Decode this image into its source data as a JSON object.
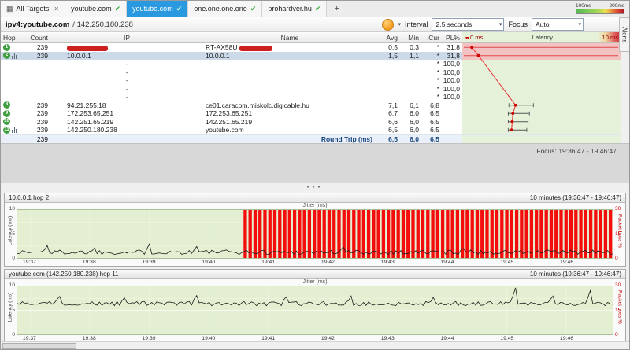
{
  "tabs": [
    {
      "label": "All Targets",
      "icon": "grid",
      "close": "✕"
    },
    {
      "label": "youtube.com",
      "check": "✔"
    },
    {
      "label": "youtube.com",
      "check": "✔",
      "active": true
    },
    {
      "label": "one.one.one.one",
      "check": "✔"
    },
    {
      "label": "prohardver.hu",
      "check": "✔"
    },
    {
      "label": "+",
      "plus": true
    }
  ],
  "legend": {
    "label1": "100ms",
    "label2": "200ms"
  },
  "alerts_label": "Alerts",
  "toolbar": {
    "target": "ipv4:youtube.com",
    "target_ip": "/ 142.250.180.238",
    "interval_label": "Interval",
    "interval_value": "2.5 seconds",
    "focus_label": "Focus",
    "focus_value": "Auto"
  },
  "table": {
    "header": {
      "hop": "Hop",
      "count": "Count",
      "ip": "IP",
      "name": "Name",
      "avg": "Avg",
      "min": "Min",
      "cur": "Cur",
      "pl": "PL%",
      "lat_left": "0 ms",
      "lat_title": "Latency",
      "lat_right": "10 ms"
    },
    "rows": [
      {
        "hop": "1",
        "count": "239",
        "ip": "",
        "ip_redacted": true,
        "name": "RT-AX58U",
        "name_redacted": true,
        "avg": "0,5",
        "min": "0,3",
        "cur": "*",
        "pl": "31,8",
        "loss": true,
        "lat": {
          "min": 0.3,
          "avg": 0.5,
          "max": 20
        }
      },
      {
        "hop": "2",
        "count": "239",
        "ip": "10.0.0.1",
        "name": "10.0.0.1",
        "avg": "1,5",
        "min": "1,1",
        "cur": "*",
        "pl": "31,8",
        "loss": true,
        "selected": true,
        "chart_icon": true,
        "lat": {
          "min": 1.1,
          "avg": 1.5,
          "max": 20
        }
      },
      {
        "dash": "-",
        "cur": "*",
        "pl": "100,0"
      },
      {
        "dash": "-",
        "cur": "*",
        "pl": "100,0"
      },
      {
        "dash": "-",
        "cur": "*",
        "pl": "100,0"
      },
      {
        "dash": "-",
        "cur": "*",
        "pl": "100,0"
      },
      {
        "dash": "-",
        "cur": "*",
        "pl": "100,0"
      },
      {
        "hop": "8",
        "count": "239",
        "ip": "94.21.255.18",
        "name": "ce01.caracom.miskolc.digicable.hu",
        "avg": "7,1",
        "min": "6,1",
        "cur": "6,8",
        "lat": {
          "min": 6.1,
          "avg": 7.1,
          "max": 9.8
        }
      },
      {
        "hop": "9",
        "count": "239",
        "ip": "172.253.65.251",
        "name": "172.253.65.251",
        "avg": "6,7",
        "min": "6,0",
        "cur": "6,5",
        "lat": {
          "min": 6.0,
          "avg": 6.7,
          "max": 9.2
        }
      },
      {
        "hop": "10",
        "count": "239",
        "ip": "142.251.65.219",
        "name": "142.251.65.219",
        "avg": "6,6",
        "min": "6,0",
        "cur": "6,5",
        "lat": {
          "min": 6.0,
          "avg": 6.6,
          "max": 9.0
        }
      },
      {
        "hop": "11",
        "count": "239",
        "ip": "142.250.180.238",
        "name": "youtube.com",
        "avg": "6,5",
        "min": "6,0",
        "cur": "6,5",
        "chart_icon": true,
        "lat": {
          "min": 6.0,
          "avg": 6.5,
          "max": 8.8
        }
      }
    ],
    "round_trip": {
      "count": "239",
      "label": "Round Trip (ms)",
      "avg": "6,5",
      "min": "6,0",
      "cur": "6,5"
    },
    "focus_text": "Focus: 19:36:47 - 19:46:47"
  },
  "scale_max_ms": 20,
  "graphs": [
    {
      "title": "10.0.0.1 hop 2",
      "range": "10 minutes (19:36:47 - 19:46:47)",
      "top_label": "Jitter (ms)",
      "y_left": "Latency (ms)",
      "y_right": "Packet Loss %",
      "left_ticks": [
        "10",
        "5",
        "0"
      ],
      "right_ticks": [
        "30",
        "15",
        "0"
      ],
      "x_ticks": [
        "19:37",
        "19:38",
        "19:39",
        "19:40",
        "19:41",
        "19:42",
        "19:43",
        "19:44",
        "19:45",
        "19:46"
      ],
      "y_left_max": 10,
      "y_right_max": 30,
      "latency_baseline": 1.2,
      "latency_jitter": 0.5,
      "latency_spikes": [
        [
          0.05,
          2.6
        ],
        [
          0.13,
          2.1
        ],
        [
          0.22,
          2.9
        ],
        [
          0.3,
          2.4
        ],
        [
          0.55,
          2.2
        ],
        [
          0.75,
          2.0
        ]
      ],
      "loss": {
        "start": 0.38,
        "end": 1.0,
        "value": 30
      }
    },
    {
      "title": "youtube.com (142.250.180.238) hop 11",
      "range": "10 minutes (19:36:47 - 19:46:47)",
      "top_label": "Jitter (ms)",
      "y_left": "Latency (ms)",
      "y_right": "Packet Loss %",
      "left_ticks": [
        "10",
        "5",
        "0"
      ],
      "right_ticks": [
        "30",
        "15",
        "0"
      ],
      "x_ticks": [
        "19:37",
        "19:38",
        "19:39",
        "19:40",
        "19:41",
        "19:42",
        "19:43",
        "19:44",
        "19:45",
        "19:46"
      ],
      "y_left_max": 10,
      "y_right_max": 30,
      "latency_baseline": 6.4,
      "latency_jitter": 0.45,
      "latency_spikes": [
        [
          0.07,
          7.9
        ],
        [
          0.18,
          7.6
        ],
        [
          0.3,
          8.1
        ],
        [
          0.45,
          7.8
        ],
        [
          0.56,
          8.0
        ],
        [
          0.7,
          7.7
        ],
        [
          0.835,
          9.7
        ],
        [
          0.9,
          8.0
        ],
        [
          0.962,
          9.1
        ]
      ],
      "loss": null
    }
  ]
}
